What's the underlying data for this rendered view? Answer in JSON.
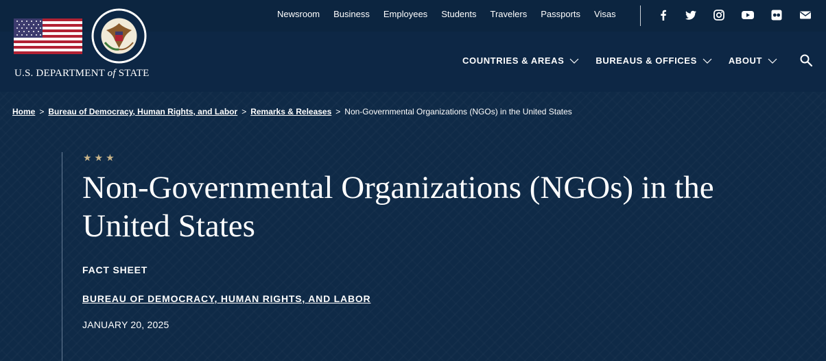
{
  "header": {
    "dept_name_pre": "U.S. DEPARTMENT",
    "dept_name_of": "of",
    "dept_name_post": "STATE",
    "util_nav": [
      "Newsroom",
      "Business",
      "Employees",
      "Students",
      "Travelers",
      "Passports",
      "Visas"
    ],
    "social_icons": [
      "facebook-icon",
      "twitter-icon",
      "instagram-icon",
      "youtube-icon",
      "flickr-icon",
      "email-icon"
    ],
    "main_nav": [
      {
        "label": "COUNTRIES & AREAS"
      },
      {
        "label": "BUREAUS & OFFICES"
      },
      {
        "label": "ABOUT"
      }
    ]
  },
  "breadcrumb": {
    "items": [
      "Home",
      "Bureau of Democracy, Human Rights, and Labor",
      "Remarks & Releases"
    ],
    "separator": ">",
    "current": "Non-Governmental Organizations (NGOs) in the United States"
  },
  "article": {
    "stars": "★★★",
    "title": "Non-Governmental Organizations (NGOs) in the United States",
    "type": "FACT SHEET",
    "bureau": "BUREAU OF DEMOCRACY, HUMAN RIGHTS, AND LABOR",
    "date": "JANUARY 20, 2025"
  },
  "colors": {
    "background": "#0f2a47",
    "topbar": "#0c2540",
    "star_gold": "#c8b48a"
  }
}
